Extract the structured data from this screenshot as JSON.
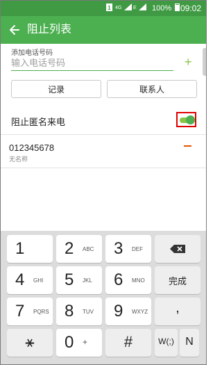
{
  "status_bar": {
    "sim_label": "1",
    "network_4g": "4G",
    "network_e": "E",
    "battery_percent": "100%",
    "time": "09:02"
  },
  "header": {
    "title": "阻止列表"
  },
  "add_number": {
    "label": "添加电话号码",
    "placeholder": "输入电话号码",
    "value": ""
  },
  "buttons": {
    "log": "记录",
    "contacts": "联系人"
  },
  "block_anonymous": {
    "label": "阻止匿名来电",
    "enabled": true
  },
  "blocked_list": [
    {
      "number": "012345678",
      "name": "无名称"
    }
  ],
  "keyboard": {
    "rows": [
      [
        {
          "digit": "1",
          "letters": ""
        },
        {
          "digit": "2",
          "letters": "ABC"
        },
        {
          "digit": "3",
          "letters": "DEF"
        },
        {
          "label": "backspace"
        }
      ],
      [
        {
          "digit": "4",
          "letters": "GHI"
        },
        {
          "digit": "5",
          "letters": "JKL"
        },
        {
          "digit": "6",
          "letters": "MNO"
        },
        {
          "label": "完成"
        }
      ],
      [
        {
          "digit": "7",
          "letters": "PQRS"
        },
        {
          "digit": "8",
          "letters": "TUV"
        },
        {
          "digit": "9",
          "letters": "WXYZ"
        },
        {
          "label": ","
        }
      ],
      [
        {
          "label": "⚹"
        },
        {
          "digit": "0",
          "letters": "+"
        },
        {
          "label": "#"
        },
        {
          "label": "W(;)"
        },
        {
          "label": "N"
        }
      ]
    ]
  },
  "colors": {
    "accent": "#4caf50",
    "status_bar": "#3f9a43",
    "highlight": "#e00000",
    "remove": "#e65100"
  }
}
